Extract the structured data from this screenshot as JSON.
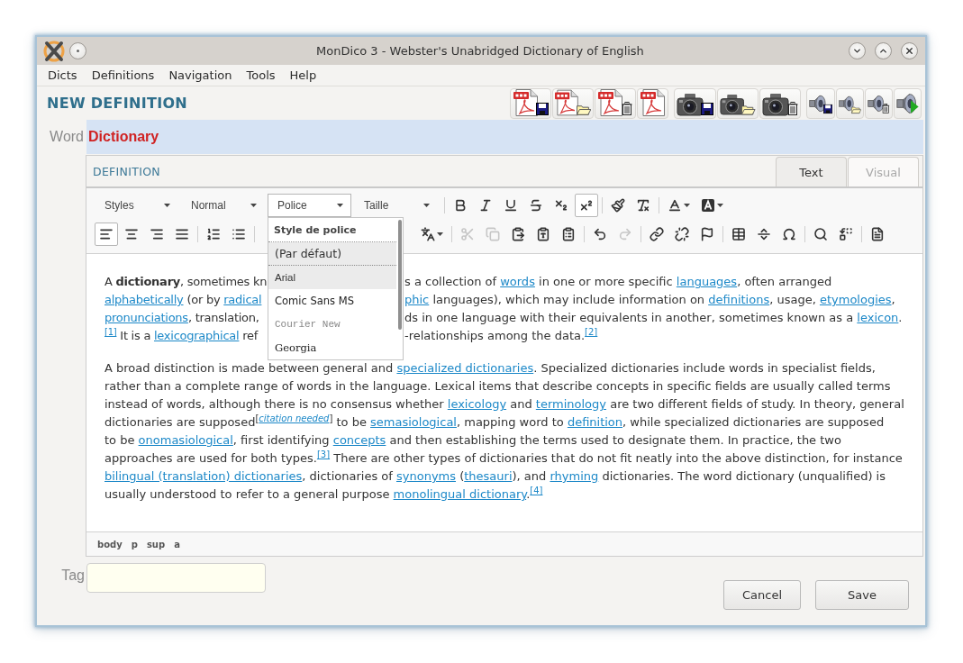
{
  "window": {
    "title": "MonDico 3 - Webster's Unabridged Dictionary of English"
  },
  "menu": [
    "Dicts",
    "Definitions",
    "Navigation",
    "Tools",
    "Help"
  ],
  "heading": "NEW DEFINITION",
  "word": {
    "label": "Word",
    "value": "Dictionary"
  },
  "editor": {
    "section_label": "DEFINITION",
    "tabs": [
      {
        "label": "Text",
        "selected": true
      },
      {
        "label": "Visual",
        "selected": false
      }
    ],
    "combos": [
      {
        "label": "Styles",
        "open": false
      },
      {
        "label": "Normal",
        "open": false
      },
      {
        "label": "Police",
        "open": true
      },
      {
        "label": "Taille",
        "open": false
      }
    ],
    "row_1": [
      [
        {
          "kind": "bold",
          "pressed": false,
          "disabled": false
        },
        {
          "kind": "italic",
          "pressed": false,
          "disabled": false
        },
        {
          "kind": "underline",
          "pressed": false,
          "disabled": false
        },
        {
          "kind": "strike",
          "pressed": false,
          "disabled": false
        },
        {
          "kind": "subscript",
          "pressed": false,
          "disabled": false
        },
        {
          "kind": "superscript",
          "pressed": true,
          "disabled": false
        }
      ],
      [
        {
          "kind": "copy_format",
          "pressed": false,
          "disabled": false
        },
        {
          "kind": "remove_format",
          "pressed": false,
          "disabled": false
        }
      ],
      [
        {
          "kind": "text_color",
          "pressed": false,
          "disabled": false
        },
        {
          "kind": "background_color",
          "pressed": false,
          "disabled": false
        }
      ]
    ],
    "row_2": [
      [
        {
          "kind": "align_left",
          "pressed": true,
          "disabled": false
        },
        {
          "kind": "align_center",
          "pressed": false,
          "disabled": false
        },
        {
          "kind": "align_right",
          "pressed": false,
          "disabled": false
        },
        {
          "kind": "justify",
          "pressed": false,
          "disabled": false
        }
      ],
      [
        {
          "kind": "numbered_list",
          "pressed": false,
          "disabled": false
        },
        {
          "kind": "bulleted_list",
          "pressed": false,
          "disabled": false
        }
      ],
      [
        {
          "kind": "language",
          "pressed": false,
          "disabled": false
        }
      ],
      [
        {
          "kind": "cut",
          "pressed": false,
          "disabled": true
        },
        {
          "kind": "copy",
          "pressed": false,
          "disabled": true
        },
        {
          "kind": "paste",
          "pressed": false,
          "disabled": false
        },
        {
          "kind": "paste_text",
          "pressed": false,
          "disabled": false
        },
        {
          "kind": "paste_word",
          "pressed": false,
          "disabled": false
        }
      ],
      [
        {
          "kind": "undo",
          "pressed": false,
          "disabled": false
        },
        {
          "kind": "redo",
          "pressed": false,
          "disabled": true
        }
      ],
      [
        {
          "kind": "link",
          "pressed": false,
          "disabled": false
        },
        {
          "kind": "unlink",
          "pressed": false,
          "disabled": false
        },
        {
          "kind": "anchor",
          "pressed": false,
          "disabled": false
        }
      ],
      [
        {
          "kind": "table",
          "pressed": false,
          "disabled": false
        },
        {
          "kind": "horizontal_rule",
          "pressed": false,
          "disabled": false
        },
        {
          "kind": "special_character",
          "pressed": false,
          "disabled": false
        }
      ],
      [
        {
          "kind": "find",
          "pressed": false,
          "disabled": false
        },
        {
          "kind": "replace",
          "pressed": false,
          "disabled": false
        }
      ],
      [
        {
          "kind": "show_blocks",
          "pressed": false,
          "disabled": false
        }
      ]
    ],
    "font_menu": {
      "title": "Style de police",
      "items": [
        {
          "label": "(Par défaut)",
          "selected": true,
          "highlighted": false
        },
        {
          "label": "Arial",
          "selected": false,
          "highlighted": true
        },
        {
          "label": "Comic Sans MS",
          "selected": false,
          "highlighted": false
        },
        {
          "label": "Courier New",
          "selected": false,
          "highlighted": false
        },
        {
          "label": "Georgia",
          "selected": false,
          "highlighted": false
        }
      ]
    },
    "paragraphs": [
      {
        "lines": [
          {
            "segments": [
              [
                {
                  "kind": "text",
                  "text": "A **dictionary**, sometimes kn"
                }
              ],
              [
                {
                  "kind": "text",
                  "text": "s a collection of "
                },
                {
                  "kind": "link",
                  "text": "words"
                },
                {
                  "kind": "text",
                  "text": " in one or more specific "
                },
                {
                  "kind": "link",
                  "text": "languages"
                },
                {
                  "kind": "text",
                  "text": ", often arranged"
                }
              ]
            ]
          },
          {
            "segments": [
              [
                {
                  "kind": "link",
                  "text": "alphabetically"
                },
                {
                  "kind": "text",
                  "text": " (or by "
                },
                {
                  "kind": "link",
                  "text": "radical"
                }
              ],
              [
                {
                  "kind": "link",
                  "text": "phic"
                },
                {
                  "kind": "text",
                  "text": " languages), which may include information on "
                },
                {
                  "kind": "link",
                  "text": "definitions"
                },
                {
                  "kind": "text",
                  "text": ", usage, "
                },
                {
                  "kind": "link",
                  "text": "etymologies"
                },
                {
                  "kind": "text",
                  "text": ","
                }
              ]
            ]
          },
          {
            "segments": [
              [
                {
                  "kind": "link",
                  "text": "pronunciations"
                },
                {
                  "kind": "text",
                  "text": ", translation,"
                }
              ],
              [
                {
                  "kind": "text",
                  "text": "ds in one language with their equivalents in another, sometimes known as a "
                },
                {
                  "kind": "link",
                  "text": "lexicon"
                },
                {
                  "kind": "text",
                  "text": "."
                }
              ]
            ]
          },
          {
            "segments": [
              [
                {
                  "kind": "ref",
                  "text": "[1]"
                },
                {
                  "kind": "text",
                  "text": " It is a "
                },
                {
                  "kind": "link",
                  "text": "lexicographical"
                },
                {
                  "kind": "text",
                  "text": " ref"
                }
              ],
              [
                {
                  "kind": "text",
                  "text": "-relationships among the data."
                },
                {
                  "kind": "ref",
                  "text": "[2]"
                }
              ]
            ]
          }
        ]
      },
      {
        "lines": [
          {
            "segments": [
              [
                {
                  "kind": "text",
                  "text": "A broad distinction is made between general and "
                },
                {
                  "kind": "link",
                  "text": "specialized dictionaries"
                },
                {
                  "kind": "text",
                  "text": ". Specialized dictionaries include words in specialist fields,"
                }
              ]
            ]
          },
          {
            "segments": [
              [
                {
                  "kind": "text",
                  "text": "rather than a complete range of words in the language. Lexical items that describe concepts in specific fields are usually called terms"
                }
              ]
            ]
          },
          {
            "segments": [
              [
                {
                  "kind": "text",
                  "text": "instead of words, although there is no consensus whether "
                },
                {
                  "kind": "link",
                  "text": "lexicology"
                },
                {
                  "kind": "text",
                  "text": " and "
                },
                {
                  "kind": "link",
                  "text": "terminology"
                },
                {
                  "kind": "text",
                  "text": " are two different fields of study. In theory, general"
                }
              ]
            ]
          },
          {
            "segments": [
              [
                {
                  "kind": "text",
                  "text": "dictionaries are supposed"
                },
                {
                  "kind": "sup",
                  "text": "["
                },
                {
                  "kind": "note",
                  "text": "citation needed"
                },
                {
                  "kind": "sup",
                  "text": "]"
                },
                {
                  "kind": "text",
                  "text": " to be "
                },
                {
                  "kind": "link",
                  "text": "semasiological"
                },
                {
                  "kind": "text",
                  "text": ", mapping word to "
                },
                {
                  "kind": "link",
                  "text": "definition"
                },
                {
                  "kind": "text",
                  "text": ", while specialized dictionaries are supposed"
                }
              ]
            ]
          },
          {
            "segments": [
              [
                {
                  "kind": "text",
                  "text": "to be "
                },
                {
                  "kind": "link",
                  "text": "onomasiological"
                },
                {
                  "kind": "text",
                  "text": ", first identifying "
                },
                {
                  "kind": "link",
                  "text": "concepts"
                },
                {
                  "kind": "text",
                  "text": " and then establishing the terms used to designate them. In practice, the two"
                }
              ]
            ]
          },
          {
            "segments": [
              [
                {
                  "kind": "text",
                  "text": "approaches are used for both types."
                },
                {
                  "kind": "ref",
                  "text": "[3]"
                },
                {
                  "kind": "text",
                  "text": " There are other types of dictionaries that do not fit neatly into the above distinction, for instance"
                }
              ]
            ]
          },
          {
            "segments": [
              [
                {
                  "kind": "link",
                  "text": "bilingual (translation) dictionaries"
                },
                {
                  "kind": "text",
                  "text": ", dictionaries of "
                },
                {
                  "kind": "link",
                  "text": "synonyms"
                },
                {
                  "kind": "text",
                  "text": " ("
                },
                {
                  "kind": "link",
                  "text": "thesauri"
                },
                {
                  "kind": "text",
                  "text": "), and "
                },
                {
                  "kind": "link",
                  "text": "rhyming"
                },
                {
                  "kind": "text",
                  "text": " dictionaries. The word dictionary (unqualified) is"
                }
              ]
            ]
          },
          {
            "segments": [
              [
                {
                  "kind": "text",
                  "text": "usually understood to refer to a general purpose "
                },
                {
                  "kind": "link",
                  "text": "monolingual dictionary"
                },
                {
                  "kind": "text",
                  "text": "."
                },
                {
                  "kind": "ref",
                  "text": "[4]"
                }
              ]
            ]
          }
        ]
      }
    ],
    "element_path": [
      "body",
      "p",
      "sup",
      "a"
    ]
  },
  "tag": {
    "label": "Tag"
  },
  "buttons": [
    "Cancel",
    "Save"
  ]
}
